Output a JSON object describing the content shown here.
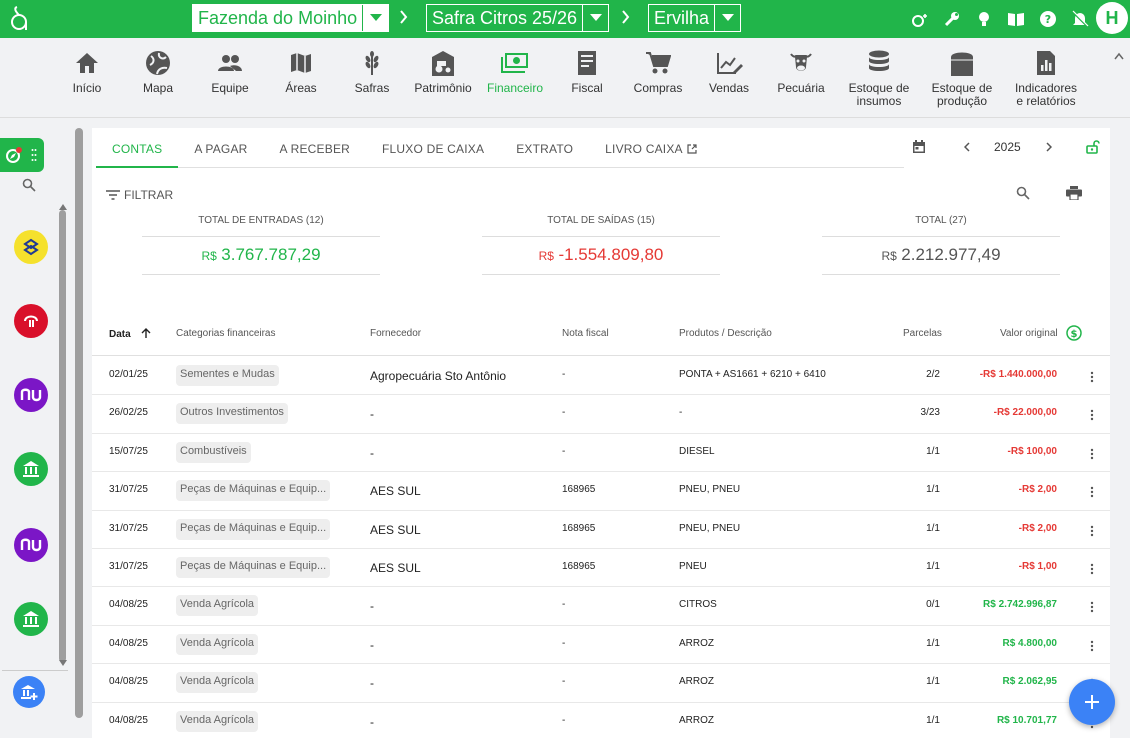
{
  "header": {
    "farm": "Fazenda do Moinho",
    "season": "Safra Citros 25/26",
    "crop": "Ervilha",
    "avatar_initial": "H",
    "brand_color": "#21b54a"
  },
  "modules": [
    {
      "label": "Início",
      "icon": "home-icon"
    },
    {
      "label": "Mapa",
      "icon": "globe-icon"
    },
    {
      "label": "Equipe",
      "icon": "people-icon"
    },
    {
      "label": "Áreas",
      "icon": "map-icon"
    },
    {
      "label": "Safras",
      "icon": "wheat-icon"
    },
    {
      "label": "Patrimônio",
      "icon": "tractor-icon"
    },
    {
      "label": "Financeiro",
      "icon": "money-icon"
    },
    {
      "label": "Fiscal",
      "icon": "invoice-icon"
    },
    {
      "label": "Compras",
      "icon": "cart-icon"
    },
    {
      "label": "Vendas",
      "icon": "chart-edit-icon"
    },
    {
      "label": "Pecuária",
      "icon": "cow-icon"
    },
    {
      "label": "Estoque de insumos",
      "icon": "database-icon"
    },
    {
      "label": "Estoque de produção",
      "icon": "silo-icon"
    },
    {
      "label": "Indicadores e relatórios",
      "icon": "report-icon"
    }
  ],
  "tabs": [
    "CONTAS",
    "A PAGAR",
    "A RECEBER",
    "FLUXO DE CAIXA",
    "EXTRATO",
    "LIVRO CAIXA"
  ],
  "year": "2025",
  "filter_label": "FILTRAR",
  "totals": [
    {
      "label": "TOTAL DE ENTRADAS (12)",
      "currency": "R$",
      "amount": "3.767.787,29",
      "color": "green"
    },
    {
      "label": "TOTAL DE SAÍDAS (15)",
      "currency": "R$",
      "amount": "-1.554.809,80",
      "color": "red"
    },
    {
      "label": "TOTAL (27)",
      "currency": "R$",
      "amount": "2.212.977,49",
      "color": "grey"
    }
  ],
  "table": {
    "headers": {
      "date": "Data",
      "category": "Categorias financeiras",
      "supplier": "Fornecedor",
      "invoice": "Nota fiscal",
      "products": "Produtos / Descrição",
      "installments": "Parcelas",
      "value": "Valor original"
    },
    "rows": [
      {
        "date": "02/01/25",
        "category": "Sementes e Mudas",
        "supplier": "Agropecuária Sto Antônio",
        "invoice": "-",
        "products": "PONTA + AS1661 + 6210 + 6410",
        "installments": "2/2",
        "value": "-R$ 1.440.000,00",
        "kind": "red"
      },
      {
        "date": "26/02/25",
        "category": "Outros Investimentos",
        "supplier": "-",
        "invoice": "-",
        "products": "-",
        "installments": "3/23",
        "value": "-R$ 22.000,00",
        "kind": "red"
      },
      {
        "date": "15/07/25",
        "category": "Combustíveis",
        "supplier": "-",
        "invoice": "-",
        "products": "DIESEL",
        "installments": "1/1",
        "value": "-R$ 100,00",
        "kind": "red"
      },
      {
        "date": "31/07/25",
        "category": "Peças de Máquinas e Equip...",
        "supplier": "AES SUL",
        "invoice": "168965",
        "products": "PNEU, PNEU",
        "installments": "1/1",
        "value": "-R$ 2,00",
        "kind": "red"
      },
      {
        "date": "31/07/25",
        "category": "Peças de Máquinas e Equip...",
        "supplier": "AES SUL",
        "invoice": "168965",
        "products": "PNEU, PNEU",
        "installments": "1/1",
        "value": "-R$ 2,00",
        "kind": "red"
      },
      {
        "date": "31/07/25",
        "category": "Peças de Máquinas e Equip...",
        "supplier": "AES SUL",
        "invoice": "168965",
        "products": "PNEU",
        "installments": "1/1",
        "value": "-R$ 1,00",
        "kind": "red"
      },
      {
        "date": "04/08/25",
        "category": "Venda Agrícola",
        "supplier": "-",
        "invoice": "-",
        "products": "CITROS",
        "installments": "0/1",
        "value": "R$ 2.742.996,87",
        "kind": "green"
      },
      {
        "date": "04/08/25",
        "category": "Venda Agrícola",
        "supplier": "-",
        "invoice": "-",
        "products": "ARROZ",
        "installments": "1/1",
        "value": "R$ 4.800,00",
        "kind": "green"
      },
      {
        "date": "04/08/25",
        "category": "Venda Agrícola",
        "supplier": "-",
        "invoice": "-",
        "products": "ARROZ",
        "installments": "1/1",
        "value": "R$ 2.062,95",
        "kind": "green"
      },
      {
        "date": "04/08/25",
        "category": "Venda Agrícola",
        "supplier": "-",
        "invoice": "-",
        "products": "ARROZ",
        "installments": "1/1",
        "value": "R$ 10.701,77",
        "kind": "green"
      }
    ]
  },
  "sidebar_accounts": [
    {
      "icon": "bank-brasil-icon",
      "color": "#f5e12c"
    },
    {
      "icon": "bradesco-icon",
      "color": "#d9102a"
    },
    {
      "icon": "nubank-icon",
      "color": "#7b16c6"
    },
    {
      "icon": "bank-icon",
      "color": "#21b54a"
    },
    {
      "icon": "nubank-icon",
      "color": "#7b16c6"
    },
    {
      "icon": "bank-icon",
      "color": "#21b54a"
    }
  ]
}
